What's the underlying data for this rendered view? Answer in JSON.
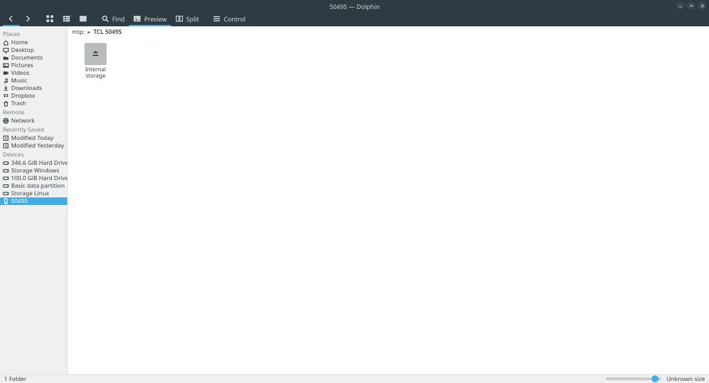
{
  "window": {
    "title": "5049S — Dolphin"
  },
  "toolbar": {
    "find_label": "Find",
    "preview_label": "Preview",
    "split_label": "Split",
    "control_label": "Control"
  },
  "sidebar": {
    "sections": [
      {
        "header": "Places",
        "items": [
          {
            "icon": "home",
            "label": "Home"
          },
          {
            "icon": "desktop",
            "label": "Desktop"
          },
          {
            "icon": "folder",
            "label": "Documents"
          },
          {
            "icon": "pictures",
            "label": "Pictures"
          },
          {
            "icon": "video",
            "label": "Videos"
          },
          {
            "icon": "music",
            "label": "Music"
          },
          {
            "icon": "download",
            "label": "Downloads"
          },
          {
            "icon": "dropbox",
            "label": "Dropbox"
          },
          {
            "icon": "trash",
            "label": "Trash"
          }
        ]
      },
      {
        "header": "Remote",
        "items": [
          {
            "icon": "network",
            "label": "Network"
          }
        ]
      },
      {
        "header": "Recently Saved",
        "items": [
          {
            "icon": "recent",
            "label": "Modified Today"
          },
          {
            "icon": "recent",
            "label": "Modified Yesterday"
          }
        ]
      },
      {
        "header": "Devices",
        "items": [
          {
            "icon": "drive",
            "label": "346.6 GiB Hard Drive"
          },
          {
            "icon": "drive",
            "label": "Storage Windows"
          },
          {
            "icon": "drive",
            "label": "100.0 GiB Hard Drive"
          },
          {
            "icon": "drive",
            "label": "Basic data partition"
          },
          {
            "icon": "drive",
            "label": "Storage Linux"
          },
          {
            "icon": "phone",
            "label": "5049S",
            "selected": true
          }
        ]
      }
    ]
  },
  "breadcrumb": {
    "segments": [
      {
        "label": "mtp:"
      },
      {
        "label": "TCL 5049S",
        "current": true
      }
    ]
  },
  "files": [
    {
      "icon": "eject-drive",
      "label": "Internal storage"
    }
  ],
  "statusbar": {
    "left": "1 Folder",
    "right": "Unknown size"
  }
}
